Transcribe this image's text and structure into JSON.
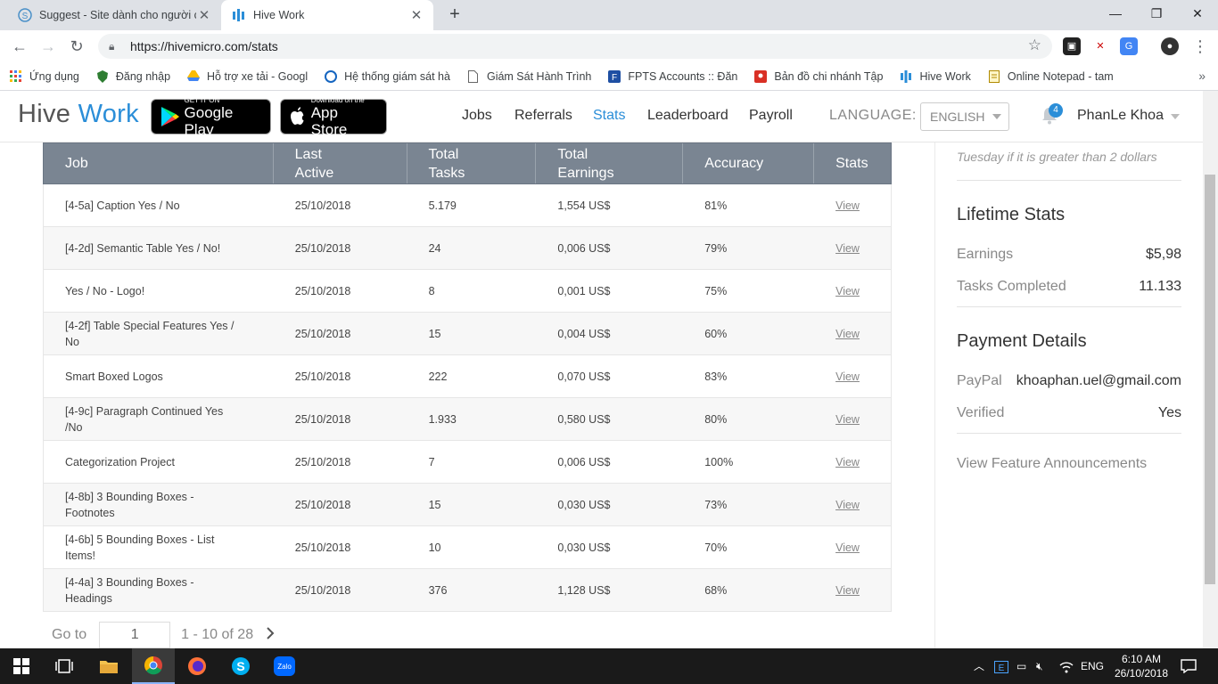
{
  "browser": {
    "tabs": [
      {
        "title": "Suggest - Site dành cho người ch",
        "active": false
      },
      {
        "title": "Hive Work",
        "active": true
      }
    ],
    "url": "https://hivemicro.com/stats",
    "bookmarks": [
      "Ứng dụng",
      "Đăng nhập",
      "Hỗ trợ xe tải - Googl",
      "Hệ thống giám sát hà",
      "Giám Sát Hành Trình",
      "FPTS Accounts :: Đăn",
      "Bản đồ chi nhánh Tập",
      "Hive Work",
      "Online Notepad - tam"
    ]
  },
  "header": {
    "logo_main": "Hive",
    "logo_accent": "Work",
    "google_play_small": "GET IT ON",
    "google_play_big": "Google Play",
    "app_store_small": "Download on the",
    "app_store_big": "App Store",
    "nav": [
      "Jobs",
      "Referrals",
      "Stats",
      "Leaderboard",
      "Payroll"
    ],
    "active_nav": "Stats",
    "language_label": "LANGUAGE:",
    "language_value": "ENGLISH",
    "notification_count": "4",
    "username": "PhanLe Khoa"
  },
  "table": {
    "headers": [
      "Job",
      "Last Active",
      "Total Tasks",
      "Total Earnings",
      "Accuracy",
      "Stats"
    ],
    "rows": [
      {
        "job": "[4-5a] Caption Yes / No",
        "last_active": "25/10/2018",
        "tasks": "5.179",
        "earnings": "1,554 US$",
        "accuracy": "81%",
        "stats": "View"
      },
      {
        "job": "[4-2d] Semantic Table Yes / No!",
        "last_active": "25/10/2018",
        "tasks": "24",
        "earnings": "0,006 US$",
        "accuracy": "79%",
        "stats": "View"
      },
      {
        "job": "Yes / No - Logo!",
        "last_active": "25/10/2018",
        "tasks": "8",
        "earnings": "0,001 US$",
        "accuracy": "75%",
        "stats": "View"
      },
      {
        "job": "[4-2f] Table Special Features Yes / No",
        "last_active": "25/10/2018",
        "tasks": "15",
        "earnings": "0,004 US$",
        "accuracy": "60%",
        "stats": "View"
      },
      {
        "job": "Smart Boxed Logos",
        "last_active": "25/10/2018",
        "tasks": "222",
        "earnings": "0,070 US$",
        "accuracy": "83%",
        "stats": "View"
      },
      {
        "job": "[4-9c] Paragraph Continued Yes /No",
        "last_active": "25/10/2018",
        "tasks": "1.933",
        "earnings": "0,580 US$",
        "accuracy": "80%",
        "stats": "View"
      },
      {
        "job": "Categorization Project",
        "last_active": "25/10/2018",
        "tasks": "7",
        "earnings": "0,006 US$",
        "accuracy": "100%",
        "stats": "View"
      },
      {
        "job": "[4-8b] 3 Bounding Boxes - Footnotes",
        "last_active": "25/10/2018",
        "tasks": "15",
        "earnings": "0,030 US$",
        "accuracy": "73%",
        "stats": "View"
      },
      {
        "job": "[4-6b] 5 Bounding Boxes - List Items!",
        "last_active": "25/10/2018",
        "tasks": "10",
        "earnings": "0,030 US$",
        "accuracy": "70%",
        "stats": "View"
      },
      {
        "job": "[4-4a] 3 Bounding Boxes - Headings",
        "last_active": "25/10/2018",
        "tasks": "376",
        "earnings": "1,128 US$",
        "accuracy": "68%",
        "stats": "View"
      }
    ]
  },
  "pagination": {
    "goto_label": "Go to",
    "page_value": "1",
    "range_text": "1 - 10 of 28"
  },
  "sidebar": {
    "payout_note": "Tuesday if it is greater than 2 dollars",
    "lifetime_title": "Lifetime Stats",
    "earnings_label": "Earnings",
    "earnings_value": "$5,98",
    "tasks_label": "Tasks Completed",
    "tasks_value": "11.133",
    "payment_title": "Payment Details",
    "paypal_label": "PayPal",
    "paypal_value": "khoaphan.uel@gmail.com",
    "verified_label": "Verified",
    "verified_value": "Yes",
    "announcements_link": "View Feature Announcements"
  },
  "taskbar": {
    "language": "ENG",
    "time": "6:10 AM",
    "date": "26/10/2018"
  },
  "colors": {
    "accent": "#2b8ed8",
    "table_header": "#7a8592"
  }
}
